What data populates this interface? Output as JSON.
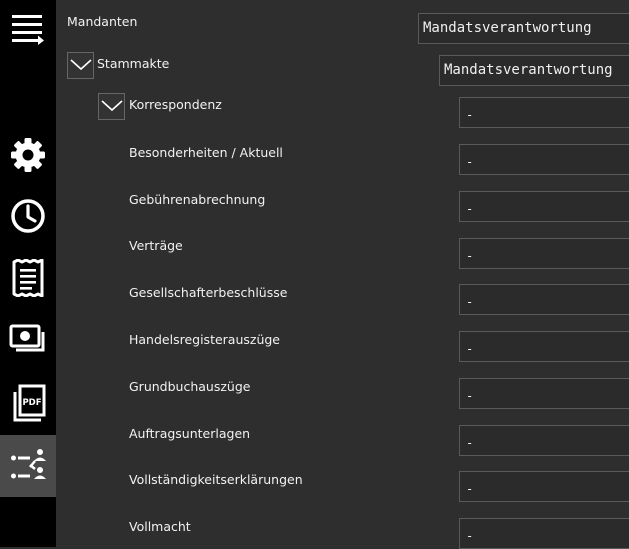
{
  "sidebar": {
    "items": [
      {
        "name": "menu-icon"
      },
      {
        "name": "gear-icon"
      },
      {
        "name": "clock-icon"
      },
      {
        "name": "receipt-icon"
      },
      {
        "name": "money-icon"
      },
      {
        "name": "pdf-icon"
      },
      {
        "name": "hierarchy-icon",
        "active": true
      }
    ],
    "pdf_text": "PDF",
    "active_color": "#4a4a4a"
  },
  "tree": {
    "root": {
      "label": "Mandanten",
      "value": "Mandatsverantwortung"
    },
    "stammakte": {
      "label": "Stammakte",
      "value": "Mandatsverantwortung"
    },
    "korrespondenz": {
      "label": "Korrespondenz",
      "value": "-"
    },
    "children": [
      {
        "label": "Besonderheiten / Aktuell",
        "value": "-"
      },
      {
        "label": "Gebührenabrechnung",
        "value": "-"
      },
      {
        "label": "Verträge",
        "value": "-"
      },
      {
        "label": "Gesellschafterbeschlüsse",
        "value": "-"
      },
      {
        "label": "Handelsregisterauszüge",
        "value": "-"
      },
      {
        "label": "Grundbuchauszüge",
        "value": "-"
      },
      {
        "label": "Auftragsunterlagen",
        "value": "-"
      },
      {
        "label": "Vollständigkeitserklärungen",
        "value": "-"
      },
      {
        "label": "Vollmacht",
        "value": "-"
      }
    ]
  }
}
